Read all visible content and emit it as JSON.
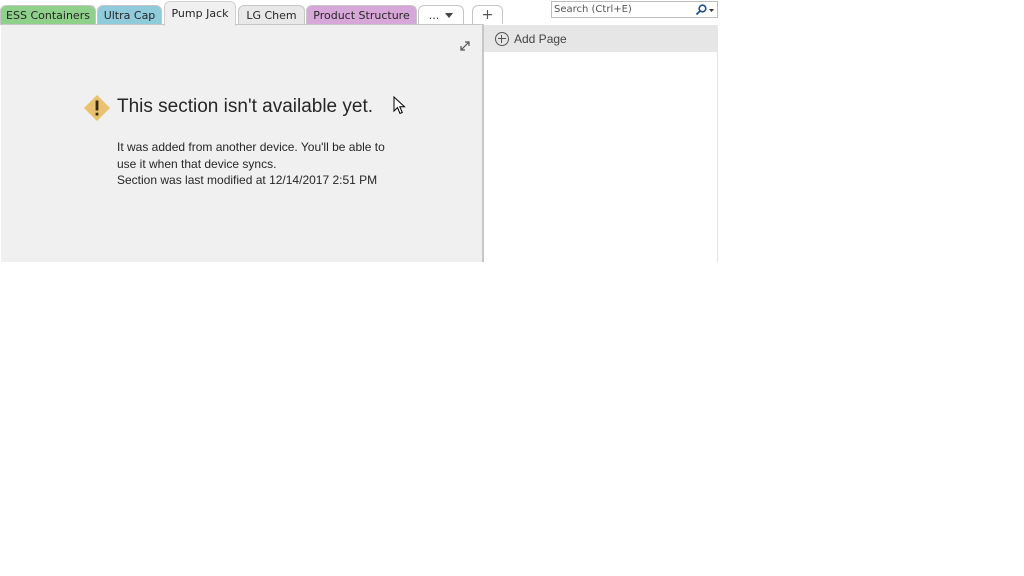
{
  "tabs": [
    {
      "label": "ESS Containers",
      "color": "#8fd18b"
    },
    {
      "label": "Ultra Cap",
      "color": "#8fcbdb"
    },
    {
      "label": "Pump Jack",
      "color": "#f0f0f0"
    },
    {
      "label": "LG Chem",
      "color": "#e8e8e8"
    },
    {
      "label": "Product Structure",
      "color": "#d7a7d9"
    },
    {
      "label": "...",
      "color": "#ffffff"
    },
    {
      "label": "+",
      "color": "#ffffff"
    }
  ],
  "search": {
    "placeholder": "Search (Ctrl+E)",
    "icon": "magnifier-icon"
  },
  "message": {
    "title": "This section isn't available yet.",
    "line1": "It was added from another device. You'll be able to use it when that device syncs.",
    "line2": "Section was last modified at 12/14/2017 2:51 PM",
    "icon": "warning-icon",
    "icon_color": "#e8c26e"
  },
  "pages_pane": {
    "add_page_label": "Add Page"
  }
}
